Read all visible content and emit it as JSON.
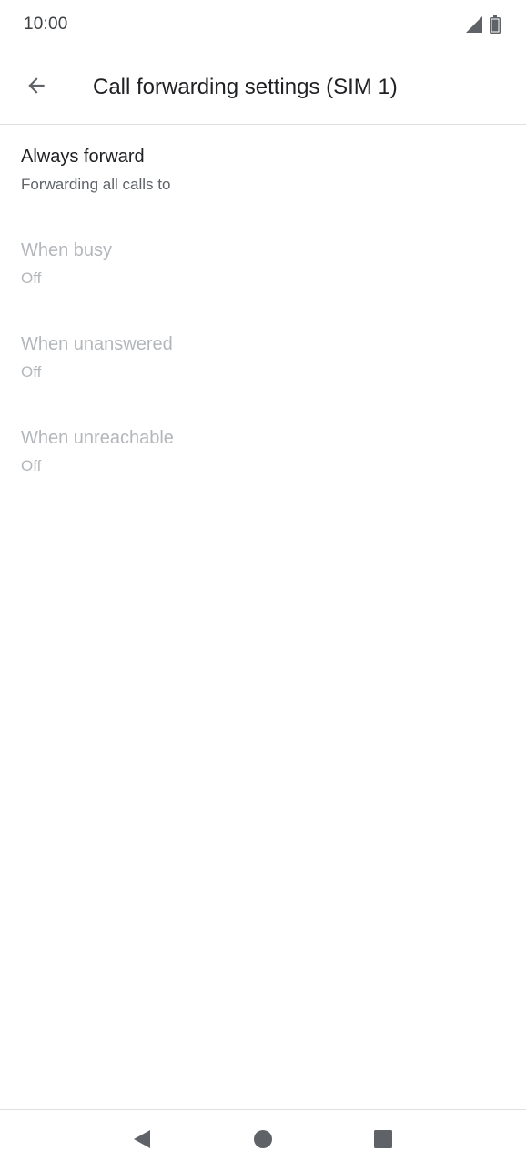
{
  "status_bar": {
    "time": "10:00",
    "icons": [
      "signal-icon",
      "battery-icon"
    ]
  },
  "app_bar": {
    "back_icon": "arrow-back-icon",
    "title": "Call forwarding settings (SIM 1)"
  },
  "settings": [
    {
      "title": "Always forward",
      "summary": "Forwarding all calls to",
      "enabled": true
    },
    {
      "title": "When busy",
      "summary": "Off",
      "enabled": false
    },
    {
      "title": "When unanswered",
      "summary": "Off",
      "enabled": false
    },
    {
      "title": "When unreachable",
      "summary": "Off",
      "enabled": false
    }
  ],
  "nav_bar": {
    "icons": [
      "nav-back-icon",
      "nav-home-icon",
      "nav-recents-icon"
    ]
  },
  "colors": {
    "primary_text": "#202124",
    "secondary_text": "#5f6368",
    "disabled_text": "#b3b6ba",
    "icon": "#5f6368",
    "divider": "#e0e0e0"
  }
}
